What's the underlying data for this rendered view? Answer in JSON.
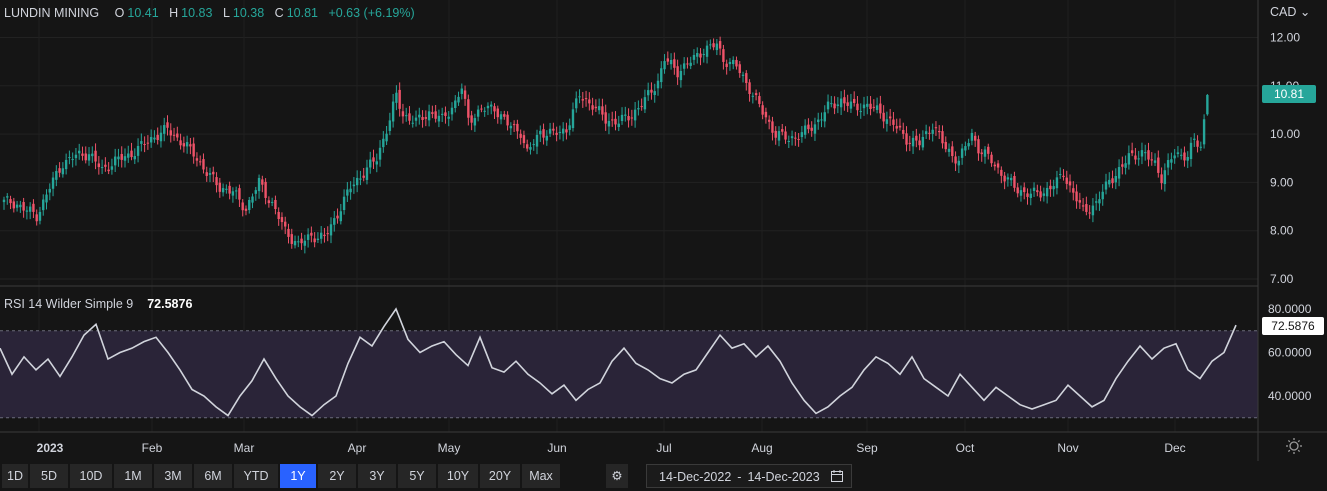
{
  "header": {
    "symbol": "LUNDIN MINING",
    "o_label": "O",
    "o_value": "10.41",
    "h_label": "H",
    "h_value": "10.83",
    "l_label": "L",
    "l_value": "10.38",
    "c_label": "C",
    "c_value": "10.81",
    "change": "+0.63 (+6.19%)"
  },
  "currency": "CAD",
  "rsi_header": {
    "label": "RSI 14 Wilder Simple 9",
    "value": "72.5876"
  },
  "price_axis": {
    "ticks": [
      "12.00",
      "11.00",
      "10.00",
      "9.00",
      "8.00",
      "7.00"
    ],
    "last_label": "10.81"
  },
  "rsi_axis": {
    "ticks": [
      "80.0000",
      "60.0000",
      "40.0000"
    ],
    "last_label": "72.5876"
  },
  "time_axis": [
    "2023",
    "Feb",
    "Mar",
    "Apr",
    "May",
    "Jun",
    "Jul",
    "Aug",
    "Sep",
    "Oct",
    "Nov",
    "Dec"
  ],
  "timeframes": [
    "1D",
    "5D",
    "10D",
    "1M",
    "3M",
    "6M",
    "YTD",
    "1Y",
    "2Y",
    "3Y",
    "5Y",
    "10Y",
    "20Y",
    "Max"
  ],
  "active_timeframe": "1Y",
  "date_range": {
    "from": "14-Dec-2022",
    "separator": "-",
    "to": "14-Dec-2023"
  },
  "colors": {
    "up": "#26a69a",
    "down": "#ef5369",
    "rsi_line": "#d1d4dc",
    "rsi_band": "#2a2438",
    "active": "#2962ff"
  },
  "chart_data": [
    {
      "type": "candlestick",
      "title": "LUNDIN MINING",
      "ylim": [
        7,
        12.5
      ],
      "x_ticks": [
        "2023",
        "Feb",
        "Mar",
        "Apr",
        "May",
        "Jun",
        "Jul",
        "Aug",
        "Sep",
        "Oct",
        "Nov",
        "Dec"
      ],
      "last": {
        "open": 10.41,
        "high": 10.83,
        "low": 10.38,
        "close": 10.81
      },
      "close_anchors": [
        [
          0,
          8.6
        ],
        [
          4,
          8.55
        ],
        [
          10,
          8.3
        ],
        [
          14,
          8.9
        ],
        [
          18,
          9.4
        ],
        [
          22,
          9.55
        ],
        [
          26,
          9.6
        ],
        [
          30,
          9.25
        ],
        [
          34,
          9.45
        ],
        [
          38,
          9.55
        ],
        [
          42,
          9.75
        ],
        [
          46,
          9.95
        ],
        [
          50,
          10.1
        ],
        [
          54,
          9.85
        ],
        [
          58,
          9.6
        ],
        [
          62,
          9.2
        ],
        [
          66,
          8.9
        ],
        [
          70,
          8.8
        ],
        [
          74,
          8.45
        ],
        [
          78,
          9.0
        ],
        [
          82,
          8.55
        ],
        [
          86,
          8.0
        ],
        [
          90,
          7.7
        ],
        [
          94,
          7.9
        ],
        [
          98,
          7.85
        ],
        [
          102,
          8.35
        ],
        [
          106,
          8.9
        ],
        [
          110,
          9.2
        ],
        [
          114,
          9.5
        ],
        [
          118,
          10.3
        ],
        [
          120,
          10.8
        ],
        [
          122,
          10.4
        ],
        [
          126,
          10.25
        ],
        [
          130,
          10.45
        ],
        [
          134,
          10.3
        ],
        [
          138,
          10.65
        ],
        [
          140,
          10.95
        ],
        [
          142,
          10.3
        ],
        [
          146,
          10.5
        ],
        [
          150,
          10.55
        ],
        [
          154,
          10.2
        ],
        [
          158,
          10.05
        ],
        [
          160,
          9.6
        ],
        [
          164,
          10.05
        ],
        [
          168,
          10.0
        ],
        [
          172,
          10.1
        ],
        [
          176,
          10.8
        ],
        [
          180,
          10.6
        ],
        [
          184,
          10.3
        ],
        [
          188,
          10.25
        ],
        [
          192,
          10.4
        ],
        [
          196,
          10.7
        ],
        [
          200,
          11.1
        ],
        [
          202,
          11.55
        ],
        [
          206,
          11.3
        ],
        [
          210,
          11.5
        ],
        [
          214,
          11.75
        ],
        [
          218,
          11.85
        ],
        [
          220,
          11.55
        ],
        [
          224,
          11.4
        ],
        [
          228,
          10.95
        ],
        [
          232,
          10.45
        ],
        [
          236,
          10.0
        ],
        [
          240,
          9.9
        ],
        [
          244,
          10.0
        ],
        [
          248,
          10.2
        ],
        [
          252,
          10.55
        ],
        [
          256,
          10.7
        ],
        [
          260,
          10.55
        ],
        [
          264,
          10.6
        ],
        [
          268,
          10.45
        ],
        [
          272,
          10.2
        ],
        [
          276,
          9.9
        ],
        [
          280,
          9.8
        ],
        [
          284,
          10.2
        ],
        [
          288,
          9.7
        ],
        [
          292,
          9.45
        ],
        [
          296,
          10.0
        ],
        [
          298,
          9.7
        ],
        [
          302,
          9.45
        ],
        [
          306,
          9.1
        ],
        [
          310,
          8.85
        ],
        [
          314,
          8.75
        ],
        [
          318,
          8.8
        ],
        [
          322,
          9.0
        ],
        [
          324,
          9.2
        ],
        [
          326,
          8.9
        ],
        [
          330,
          8.4
        ],
        [
          334,
          8.55
        ],
        [
          338,
          9.05
        ],
        [
          342,
          9.3
        ],
        [
          344,
          9.55
        ],
        [
          348,
          9.6
        ],
        [
          352,
          9.4
        ],
        [
          354,
          9.1
        ],
        [
          358,
          9.6
        ],
        [
          362,
          9.55
        ],
        [
          364,
          9.85
        ],
        [
          366,
          9.75
        ],
        [
          368,
          10.81
        ]
      ]
    },
    {
      "type": "line",
      "title": "RSI 14 Wilder Simple 9",
      "ylim": [
        26,
        82
      ],
      "levels": [
        70,
        30
      ],
      "last_value": 72.5876,
      "points": [
        [
          0,
          62
        ],
        [
          4,
          50
        ],
        [
          8,
          58
        ],
        [
          12,
          52
        ],
        [
          16,
          57
        ],
        [
          20,
          49
        ],
        [
          24,
          58
        ],
        [
          28,
          68
        ],
        [
          32,
          73
        ],
        [
          36,
          57
        ],
        [
          40,
          60
        ],
        [
          44,
          62
        ],
        [
          48,
          65
        ],
        [
          52,
          67
        ],
        [
          56,
          60
        ],
        [
          60,
          52
        ],
        [
          64,
          43
        ],
        [
          68,
          40
        ],
        [
          72,
          35
        ],
        [
          76,
          31
        ],
        [
          80,
          40
        ],
        [
          84,
          47
        ],
        [
          88,
          57
        ],
        [
          92,
          48
        ],
        [
          96,
          40
        ],
        [
          100,
          35
        ],
        [
          104,
          31
        ],
        [
          108,
          36
        ],
        [
          112,
          40
        ],
        [
          116,
          55
        ],
        [
          120,
          67
        ],
        [
          124,
          63
        ],
        [
          128,
          72
        ],
        [
          132,
          80
        ],
        [
          136,
          66
        ],
        [
          140,
          60
        ],
        [
          144,
          63
        ],
        [
          148,
          65
        ],
        [
          152,
          59
        ],
        [
          156,
          54
        ],
        [
          160,
          67
        ],
        [
          164,
          53
        ],
        [
          168,
          51
        ],
        [
          172,
          56
        ],
        [
          176,
          50
        ],
        [
          180,
          46
        ],
        [
          184,
          41
        ],
        [
          188,
          45
        ],
        [
          192,
          38
        ],
        [
          196,
          43
        ],
        [
          200,
          46
        ],
        [
          204,
          56
        ],
        [
          208,
          62
        ],
        [
          212,
          55
        ],
        [
          216,
          52
        ],
        [
          220,
          48
        ],
        [
          224,
          46
        ],
        [
          228,
          50
        ],
        [
          232,
          52
        ],
        [
          236,
          60
        ],
        [
          240,
          68
        ],
        [
          244,
          62
        ],
        [
          248,
          64
        ],
        [
          252,
          58
        ],
        [
          256,
          63
        ],
        [
          260,
          56
        ],
        [
          264,
          46
        ],
        [
          268,
          38
        ],
        [
          272,
          32
        ],
        [
          276,
          35
        ],
        [
          280,
          40
        ],
        [
          284,
          44
        ],
        [
          288,
          52
        ],
        [
          292,
          58
        ],
        [
          296,
          55
        ],
        [
          300,
          50
        ],
        [
          304,
          58
        ],
        [
          308,
          48
        ],
        [
          312,
          44
        ],
        [
          316,
          40
        ],
        [
          320,
          50
        ],
        [
          324,
          44
        ],
        [
          328,
          38
        ],
        [
          332,
          44
        ],
        [
          336,
          40
        ],
        [
          340,
          36
        ],
        [
          344,
          34
        ],
        [
          348,
          36
        ],
        [
          352,
          38
        ],
        [
          356,
          45
        ],
        [
          360,
          40
        ],
        [
          364,
          35
        ],
        [
          368,
          38
        ],
        [
          372,
          48
        ],
        [
          376,
          56
        ],
        [
          380,
          63
        ],
        [
          384,
          57
        ],
        [
          388,
          62
        ],
        [
          392,
          64
        ],
        [
          396,
          52
        ],
        [
          400,
          48
        ],
        [
          404,
          56
        ],
        [
          408,
          60
        ],
        [
          412,
          72.59
        ]
      ]
    }
  ]
}
